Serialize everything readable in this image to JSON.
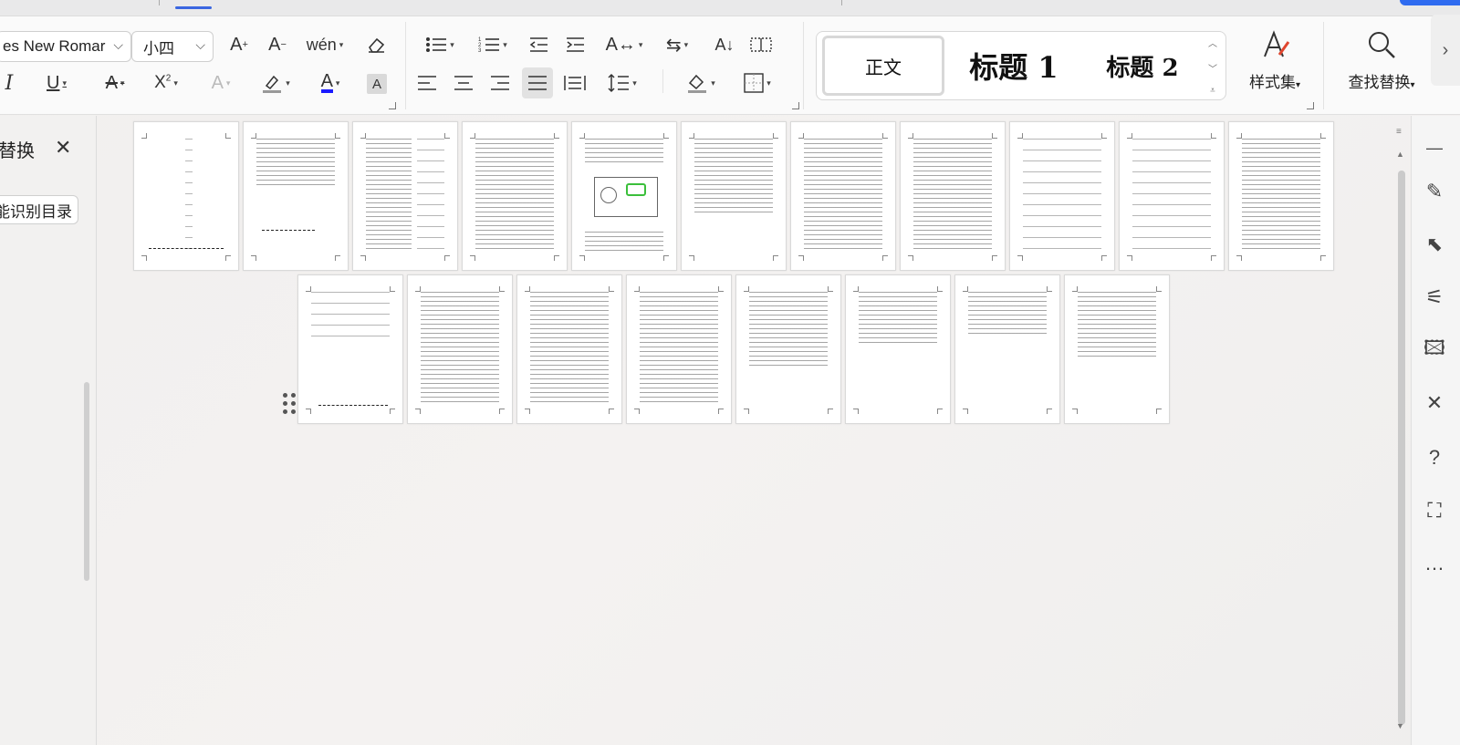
{
  "ribbon": {
    "font_name": "es New Romar",
    "font_size": "小四",
    "styles_gallery": [
      {
        "label": "正文",
        "selected": true
      },
      {
        "label": "标题 1",
        "selected": false
      },
      {
        "label": "标题 2",
        "selected": false
      }
    ],
    "styles_set_label": "样式集",
    "find_replace_label": "查找替换",
    "accent_color": "#2f6bf0",
    "font_color": "#1a1aff"
  },
  "left_panel": {
    "title": "替换",
    "close_glyph": "✕",
    "smart_toc_button": "能识别目录"
  },
  "pages": {
    "row1_count": 11,
    "row2_count": 8,
    "figure_page_highlight": "#3bbf3b"
  }
}
